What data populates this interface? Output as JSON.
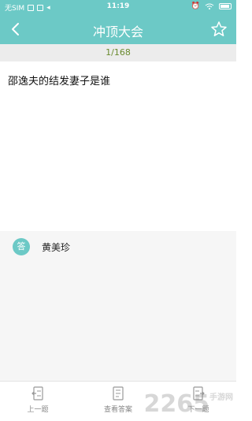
{
  "status": {
    "carrier": "无SIM",
    "time": "11:19"
  },
  "header": {
    "title": "冲顶大会"
  },
  "progress": {
    "label": "1/168"
  },
  "question": {
    "text": "邵逸夫的结发妻子是谁"
  },
  "answer": {
    "badge": "答",
    "text": "黄美珍"
  },
  "bottom_nav": {
    "prev_label": "上一题",
    "view_label": "查看答案",
    "next_label": "下一题"
  },
  "watermark": {
    "main": "2265",
    "sub": "手游网"
  },
  "colors": {
    "accent": "#6cc9c6",
    "progress_text": "#6a8b2f"
  }
}
